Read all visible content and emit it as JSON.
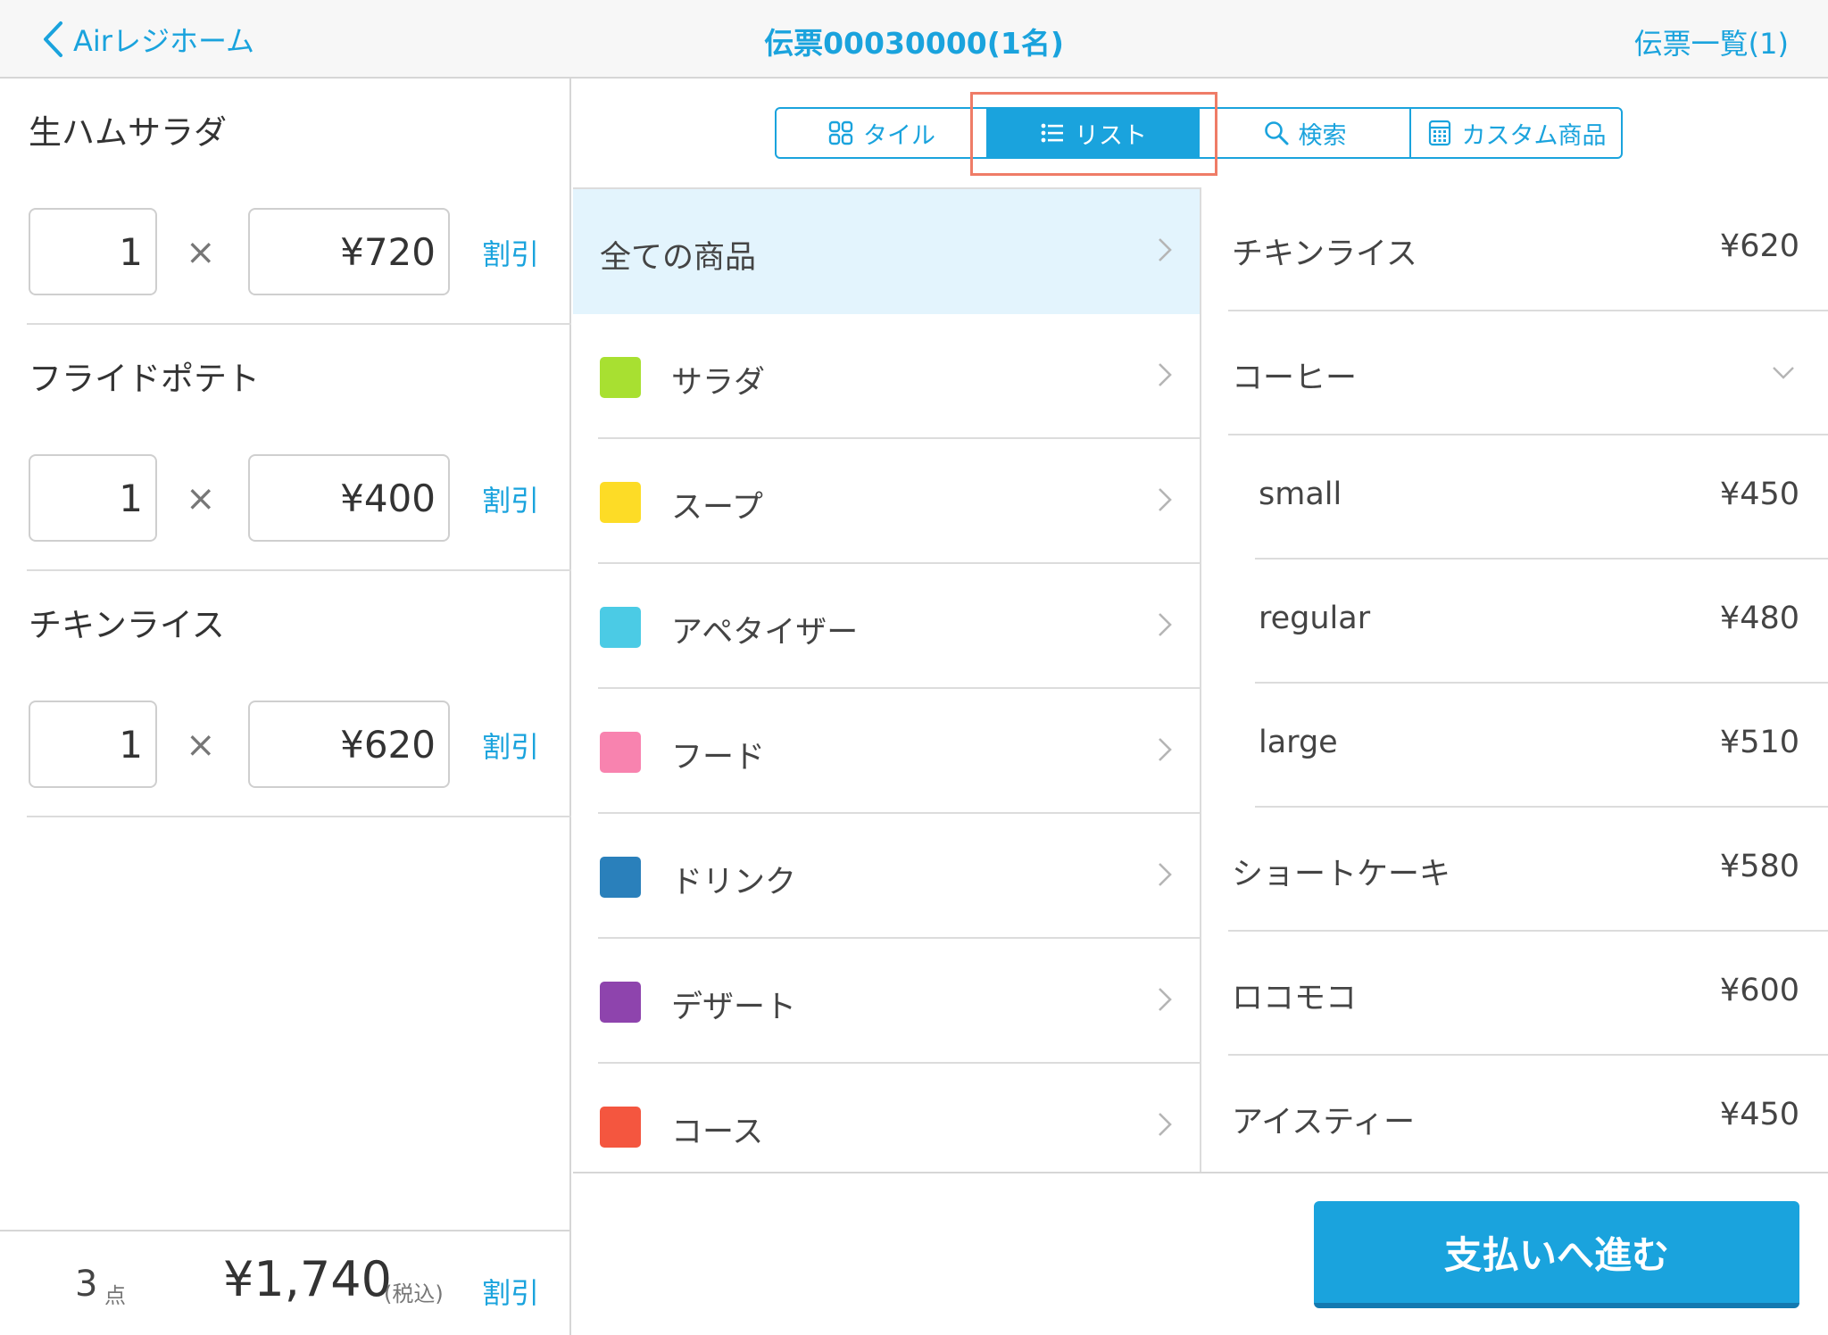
{
  "header": {
    "back_label": "Airレジホーム",
    "title": "伝票00030000(1名)",
    "slip_list": "伝票一覧(1)"
  },
  "cart": {
    "items": [
      {
        "name": "生ハムサラダ",
        "qty": "1",
        "price": "¥720"
      },
      {
        "name": "フライドポテト",
        "qty": "1",
        "price": "¥400"
      },
      {
        "name": "チキンライス",
        "qty": "1",
        "price": "¥620"
      }
    ],
    "times": "×",
    "discount_label": "割引",
    "count": "3",
    "count_unit": "点",
    "total": "¥1,740",
    "tax_note": "(税込)"
  },
  "views": {
    "tile": "タイル",
    "list": "リスト",
    "search": "検索",
    "custom": "カスタム商品",
    "active": "list"
  },
  "categories": [
    {
      "label": "全ての商品",
      "color": ""
    },
    {
      "label": "サラダ",
      "color": "#a8e031"
    },
    {
      "label": "スープ",
      "color": "#fddc26"
    },
    {
      "label": "アペタイザー",
      "color": "#4bcbe5"
    },
    {
      "label": "フード",
      "color": "#f883af"
    },
    {
      "label": "ドリンク",
      "color": "#2a80bb"
    },
    {
      "label": "デザート",
      "color": "#8e44ad"
    },
    {
      "label": "コース",
      "color": "#f4563f"
    }
  ],
  "products": [
    {
      "name": "チキンライス",
      "price": "¥620"
    },
    {
      "name": "コーヒー",
      "price": ""
    },
    {
      "name": "small",
      "price": "¥450"
    },
    {
      "name": "regular",
      "price": "¥480"
    },
    {
      "name": "large",
      "price": "¥510"
    },
    {
      "name": "ショートケーキ",
      "price": "¥580"
    },
    {
      "name": "ロコモコ",
      "price": "¥600"
    },
    {
      "name": "アイスティー",
      "price": "¥450"
    }
  ],
  "pay_button": "支払いへ進む",
  "colors": {
    "accent": "#1aa3dd",
    "highlight": "#ef7c67"
  }
}
